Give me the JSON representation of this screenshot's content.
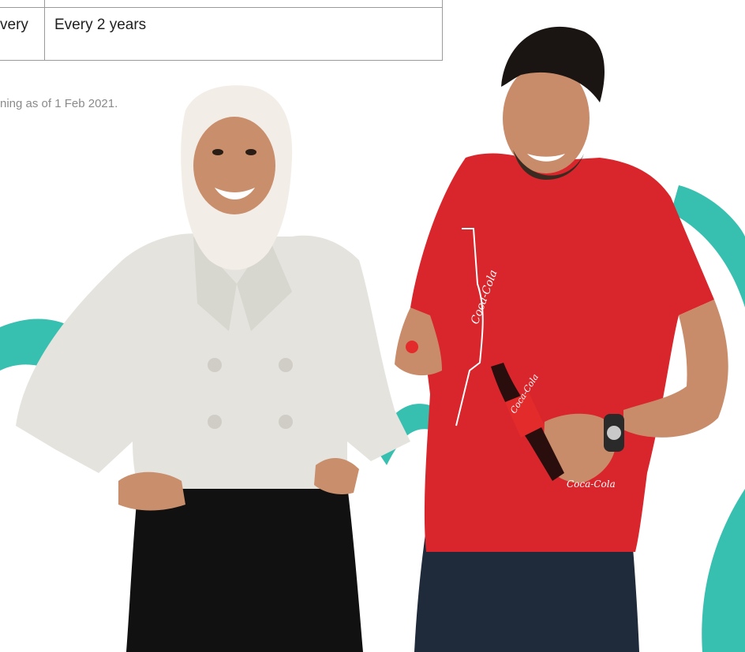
{
  "table": {
    "left_cell": "very",
    "right_cell": "Every 2 years"
  },
  "footnote": "ning as of 1 Feb 2021.",
  "photo": {
    "brand_text_shirt": "Coca-Cola",
    "brand_text_bottle": "Coca-Cola",
    "brand_text_hem": "Coca-Cola"
  },
  "colors": {
    "teal_swoosh": "#37bfb0",
    "shirt_red": "#d8262c",
    "jacket": "#e4e3dd",
    "hijab": "#f2ede6",
    "skirt": "#111111",
    "jeans": "#1f2a3a",
    "skin_woman": "#c98e6c",
    "skin_man": "#c98c6a",
    "hair": "#1a1512"
  }
}
